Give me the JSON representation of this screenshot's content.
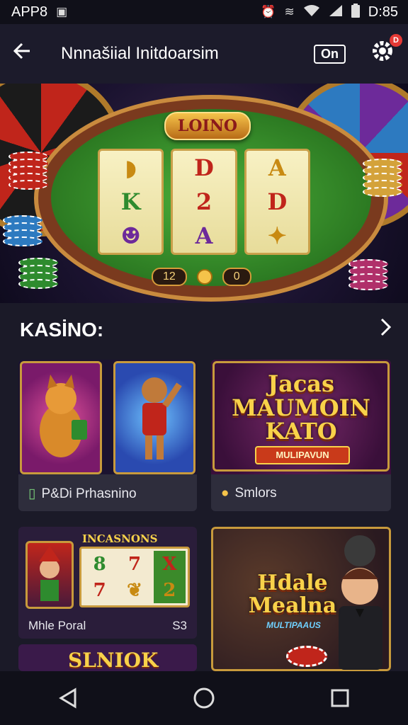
{
  "status_bar": {
    "carrier": "APP8",
    "time": "D:85",
    "icons": [
      "image-icon",
      "alarm-icon",
      "vibrate-icon",
      "wifi-icon",
      "signal-icon",
      "battery-icon"
    ]
  },
  "app_bar": {
    "title": "Nnnašiial Initdoarsim",
    "toggle_label": "On",
    "badge_count": "D"
  },
  "hero": {
    "logo_text": "LOINO",
    "reels": [
      [
        "",
        "K",
        ""
      ],
      [
        "D",
        "2",
        "A"
      ],
      [
        "A",
        "D",
        ""
      ]
    ],
    "counter_left": "12",
    "counter_right": "0"
  },
  "section": {
    "title": "KASİNO:"
  },
  "games": [
    {
      "label": "Ρ&Di Prhasnino"
    },
    {
      "title_line1": "Jacas",
      "title_line2": "MAUMOIN",
      "title_line3": "KATO",
      "ribbon": "MULIPAVUN",
      "label": "Smlors"
    },
    {
      "header": "INCASNONS",
      "reel_symbols": [
        "8",
        "7",
        "X",
        "7",
        "2"
      ],
      "label": "Mhle Poral",
      "value": "S3"
    },
    {
      "title_line1": "Hdale",
      "title_line2": "Mealna",
      "ribbon": "MULTIPAAUS"
    },
    {
      "title": "SLNIOK"
    }
  ],
  "colors": {
    "background": "#1b1a28",
    "accent_gold": "#f8d24a",
    "felt_green": "#2c7a22",
    "badge_red": "#e53935"
  }
}
